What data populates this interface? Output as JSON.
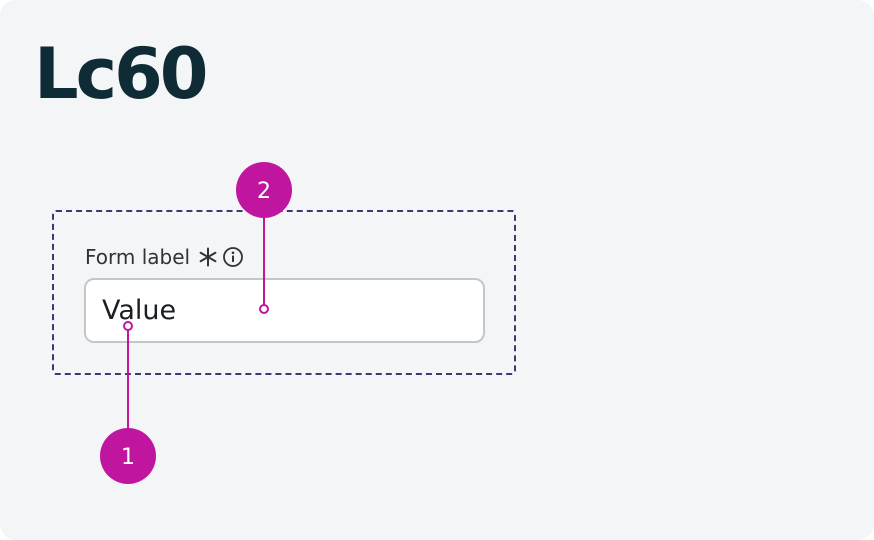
{
  "title": "Lc60",
  "field": {
    "label": "Form label",
    "required_icon": "asterisk-icon",
    "info_icon": "info-circle-icon",
    "value": "Value"
  },
  "markers": [
    {
      "number": "1"
    },
    {
      "number": "2"
    }
  ],
  "colors": {
    "background": "#f4f5f7",
    "title": "#0f2b35",
    "frame_dash": "#3a3a78",
    "marker": "#c0159f",
    "input_border": "#c2c7cc"
  }
}
